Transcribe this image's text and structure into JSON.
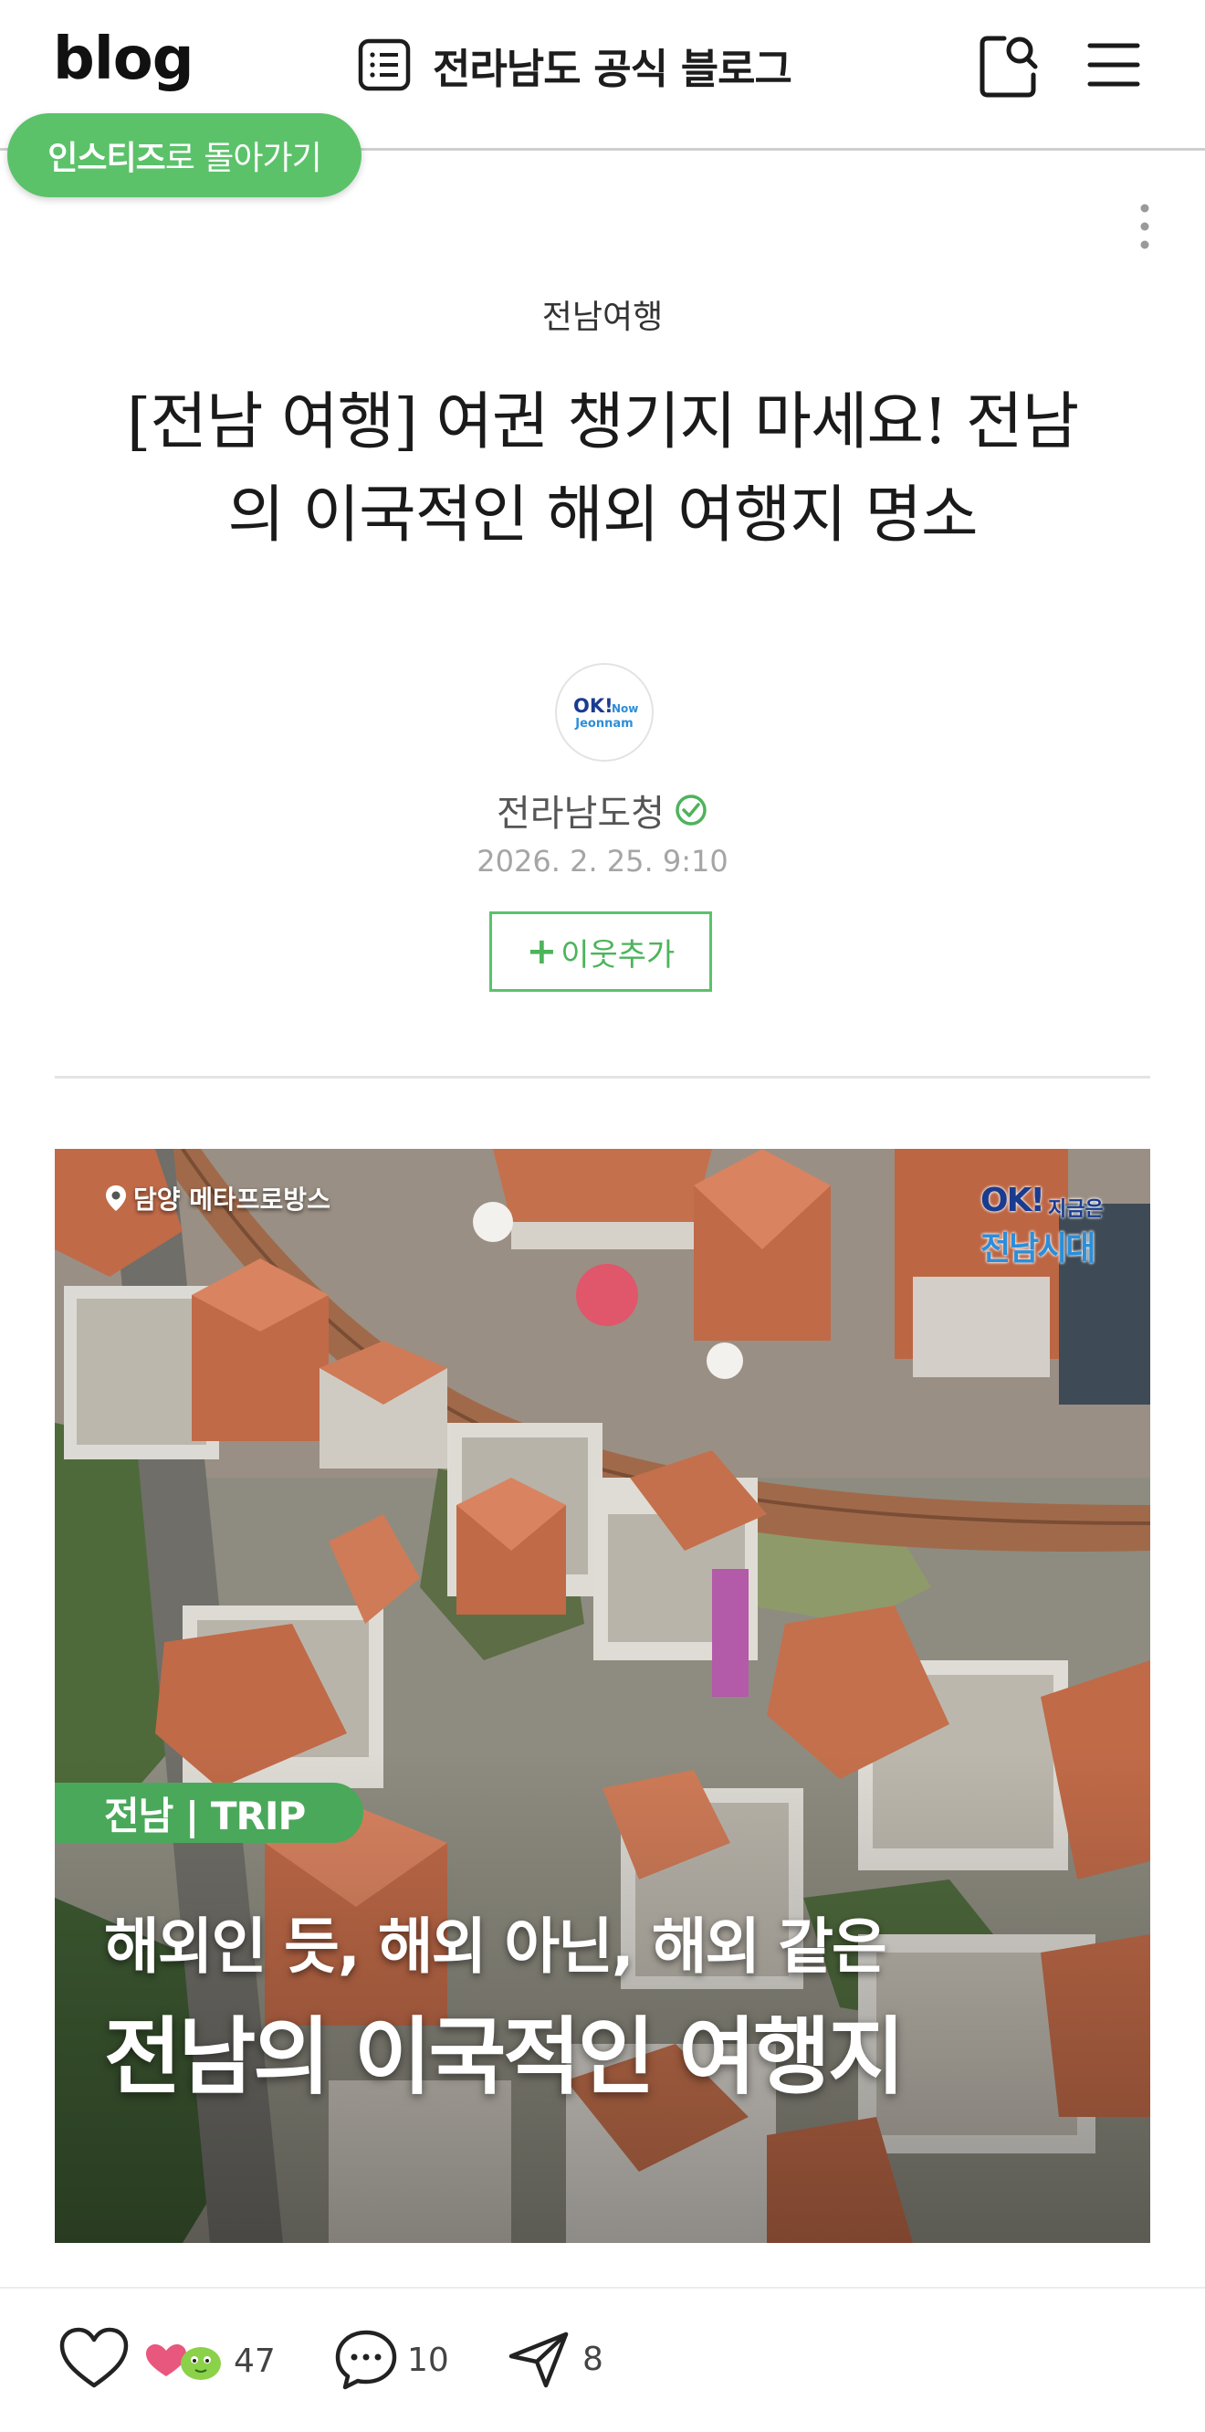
{
  "header": {
    "logo": "blog",
    "blog_name": "전라남도 공식 블로그",
    "icons": [
      "list-icon",
      "search-icon",
      "menu-icon"
    ]
  },
  "back_pill": {
    "bold": "인스티즈",
    "rest": "로 돌아가기",
    "color": "#5bc26a"
  },
  "post": {
    "category": "전남여행",
    "title_line1": "[전남 여행] 여권 챙기지 마세요! 전남",
    "title_line2": "의 이국적인 해외 여행지 명소",
    "author": "전라남도청",
    "date": "2026. 2. 25. 9:10",
    "follow_plus": "+",
    "follow_label": "이웃추가"
  },
  "hero": {
    "location": "담양 메타프로방스",
    "logo_ok": "OK!",
    "logo_now": "지금은",
    "logo_era": "전남시대",
    "tag": "전남 | TRIP",
    "subtitle": "해외인 듯, 해외 아닌, 해외 같은",
    "headline": "전남의 이국적인 여행지"
  },
  "bottom_bar": {
    "like_count": "47",
    "comment_count": "10",
    "share_count": "8"
  },
  "colors": {
    "accent_green": "#5bc26a",
    "tag_green": "#4aa85a",
    "logo_navy": "#1a3c8f",
    "logo_blue": "#2c8ed8"
  }
}
